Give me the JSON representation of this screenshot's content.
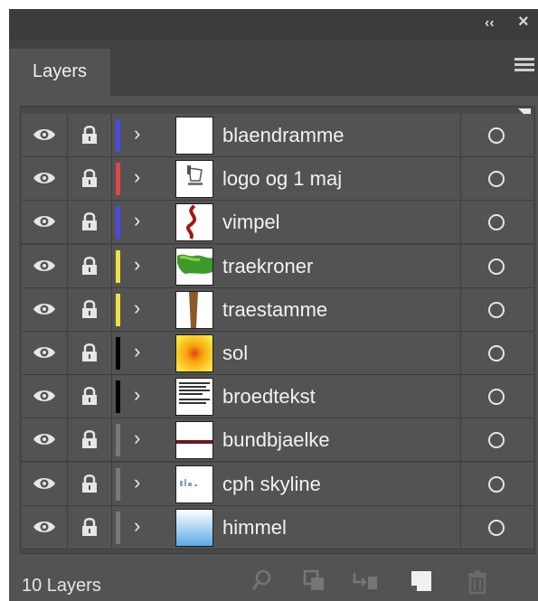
{
  "window": {
    "collapse_label": "‹‹",
    "close_label": "×"
  },
  "tabs": [
    {
      "label": "Layers",
      "active": true
    }
  ],
  "layers": [
    {
      "name": "blaendramme",
      "color": "#4a4ae8",
      "thumb": "blank-frame-thumbnail"
    },
    {
      "name": "logo og 1 maj",
      "color": "#e04848",
      "thumb": "logo-thumbnail"
    },
    {
      "name": "vimpel",
      "color": "#4a4ae8",
      "thumb": "red-pennant-thumbnail"
    },
    {
      "name": "traekroner",
      "color": "#f0e040",
      "thumb": "green-treetops-thumbnail"
    },
    {
      "name": "traestamme",
      "color": "#f0e040",
      "thumb": "brown-trunk-thumbnail"
    },
    {
      "name": "sol",
      "color": "#000000",
      "thumb": "orange-sun-thumbnail"
    },
    {
      "name": "broedtekst",
      "color": "#000000",
      "thumb": "body-text-thumbnail"
    },
    {
      "name": "bundbjaelke",
      "color": "#7a7a7a",
      "thumb": "bottom-bar-thumbnail"
    },
    {
      "name": "cph skyline",
      "color": "#7a7a7a",
      "thumb": "skyline-thumbnail"
    },
    {
      "name": "himmel",
      "color": "#7a7a7a",
      "thumb": "sky-gradient-thumbnail"
    }
  ],
  "footer": {
    "layer_count": "10 Layers",
    "icons": [
      "search-icon",
      "clipping-mask-icon",
      "move-to-layer-icon",
      "new-layer-icon",
      "delete-icon"
    ]
  }
}
